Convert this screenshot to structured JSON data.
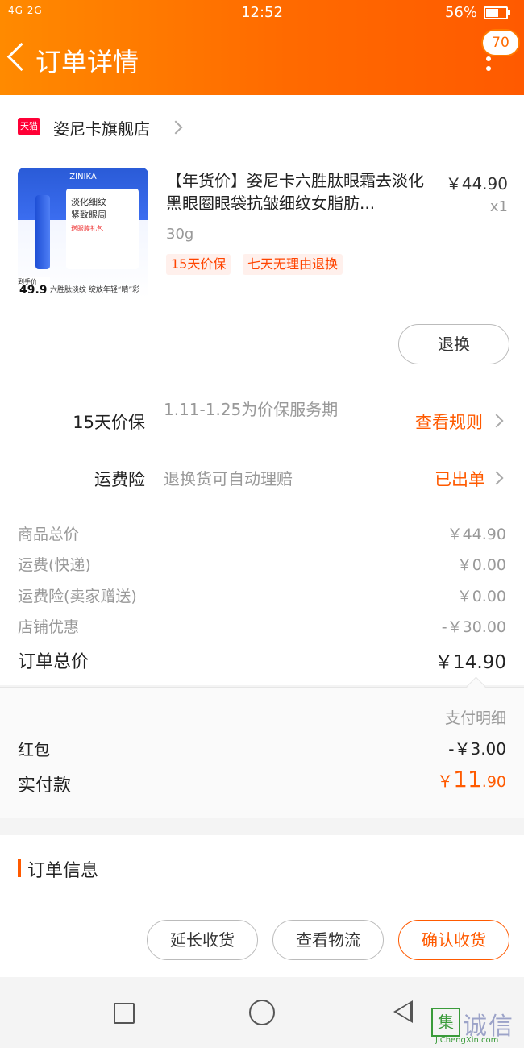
{
  "status_bar": {
    "signal_left": "4G 2G",
    "time": "12:52",
    "battery_percent": "56%",
    "battery_level": 0.56
  },
  "header": {
    "title": "订单详情",
    "badge_count": "70"
  },
  "shop": {
    "logo_text": "天猫",
    "name": "姿尼卡旗舰店"
  },
  "product": {
    "image": {
      "brand": "ZINIKA",
      "text1": "淡化细纹",
      "text2": "紧致眼周",
      "gift": "送眼膜礼包",
      "price_label": "到手价",
      "price": "49.9",
      "slogan": "六胜肽淡纹 绽放年轻“睛”彩"
    },
    "title": "【年货价】姿尼卡六胜肽眼霜去淡化黑眼圈眼袋抗皱细纹女脂肪...",
    "price": "￥44.90",
    "qty": "x1",
    "spec": "30g",
    "tags": [
      "15天价保",
      "七天无理由退换"
    ],
    "return_button": "退换"
  },
  "services": [
    {
      "label": "15天价保",
      "desc": "1.11-1.25为价保服务期",
      "link": "查看规则"
    },
    {
      "label": "运费险",
      "desc": "退换货可自动理赔",
      "link": "已出单"
    }
  ],
  "costs": [
    {
      "label": "商品总价",
      "value": "￥44.90"
    },
    {
      "label": "运费(快递)",
      "value": "￥0.00"
    },
    {
      "label": "运费险(卖家赠送)",
      "value": "￥0.00"
    },
    {
      "label": "店铺优惠",
      "value": "-￥30.00"
    }
  ],
  "total": {
    "label": "订单总价",
    "value": "￥14.90"
  },
  "payment": {
    "detail_title": "支付明细",
    "red_packet_label": "红包",
    "red_packet_value": "-￥3.00",
    "paid_label": "实付款",
    "paid_currency": "￥",
    "paid_int": "11",
    "paid_dec": ".90"
  },
  "order_info": {
    "title": "订单信息"
  },
  "actions": {
    "extend": "延长收货",
    "logistics": "查看物流",
    "confirm": "确认收货"
  },
  "colors": {
    "accent": "#ff5a00",
    "header_start": "#ff8a00",
    "header_end": "#ff5a00"
  },
  "watermark": {
    "icon": "集",
    "text": "诚信",
    "sub": "JiChengXin.com"
  }
}
